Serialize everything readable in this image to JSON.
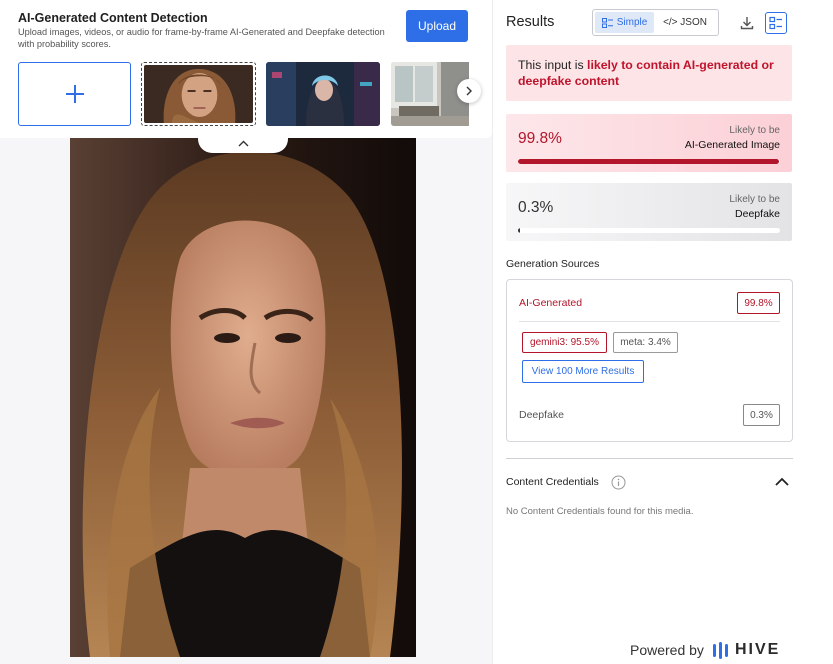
{
  "header": {
    "title": "AI-Generated Content Detection",
    "description": "Upload images, videos, or audio for frame-by-frame AI-Generated and Deepfake detection with probability scores.",
    "upload_label": "Upload"
  },
  "thumbnails": {
    "add_icon": "plus-icon",
    "next_icon": "chevron-right-icon",
    "collapse_icon": "chevron-up-icon"
  },
  "results": {
    "title": "Results",
    "tabs": [
      {
        "label": "Simple",
        "icon": "list-icon",
        "active": true
      },
      {
        "label": "</> JSON",
        "icon": "code-icon",
        "active": false
      }
    ],
    "alert": {
      "prefix": "This input is ",
      "highlight": "likely to contain AI-generated or deepfake content"
    },
    "scores": [
      {
        "value": "99.8%",
        "label_top": "Likely to be",
        "label_main": "AI-Generated Image",
        "fraction": 0.998
      },
      {
        "value": "0.3%",
        "label_top": "Likely to be",
        "label_main": "Deepfake",
        "fraction": 0.003
      }
    ],
    "generation_sources": {
      "heading": "Generation Sources",
      "ai_label": "AI-Generated",
      "ai_value": "99.8%",
      "chips": [
        "gemini3: 95.5%",
        "meta: 3.4%"
      ],
      "more_button": "View 100 More Results",
      "deepfake_label": "Deepfake",
      "deepfake_value": "0.3%"
    },
    "content_credentials": {
      "heading": "Content Credentials",
      "message": "No Content Credentials found for this media."
    },
    "footer": {
      "powered_by": "Powered by",
      "brand": "HIVE"
    }
  },
  "colors": {
    "accent": "#2e6ee6",
    "danger": "#b3152a",
    "alert_bg": "#fde4e7"
  }
}
